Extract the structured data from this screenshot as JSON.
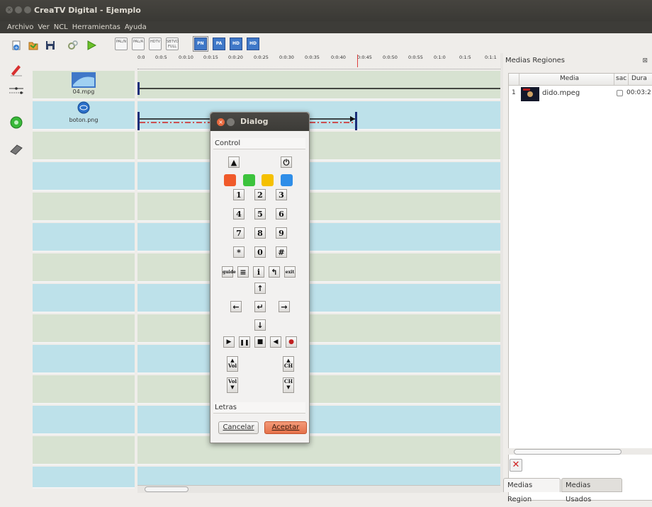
{
  "window": {
    "title": "CreaTV Digital - Ejemplo"
  },
  "menu": [
    "Archivo",
    "Ver",
    "NCL",
    "Herramientas",
    "Ayuda"
  ],
  "toolbar": {
    "format_buttons": [
      "PAL/N",
      "PAL/A",
      "HDTV",
      "SBTVD FULL"
    ],
    "resolution_buttons": [
      "PN",
      "PA",
      "HD",
      "HD"
    ]
  },
  "ruler": {
    "ticks": [
      "0:0",
      "0:0:5",
      "0:0:10",
      "0:0:15",
      "0:0:20",
      "0:0:25",
      "0:0:30",
      "0:0:35",
      "0:0:40",
      "0:0:45",
      "0:0:50",
      "0:0:55",
      "0:1:0",
      "0:1:5",
      "0:1:1"
    ]
  },
  "tracks": [
    {
      "label": "04.mpg"
    },
    {
      "label": "boton.png"
    }
  ],
  "right_panel": {
    "header": "Medias Regiones",
    "columns": [
      "Media",
      "sac",
      "Dura"
    ],
    "rows": [
      {
        "index": "1",
        "name": "dido.mpeg",
        "duration": "00:03:2"
      }
    ],
    "tabs": [
      "Medias Region",
      "Medias Usados"
    ]
  },
  "dialog": {
    "title": "Dialog",
    "section_control": "Control",
    "section_letras": "Letras",
    "numbers": [
      "1",
      "2",
      "3",
      "4",
      "5",
      "6",
      "7",
      "8",
      "9",
      "*",
      "0",
      "#"
    ],
    "guide": "guide",
    "info": "i",
    "exit": "exit",
    "vol": "Vol",
    "ch": "CH",
    "cancel": "Cancelar",
    "accept": "Aceptar",
    "colors": [
      "#f05a2a",
      "#3cc33c",
      "#f5c000",
      "#2f8ee8"
    ]
  }
}
